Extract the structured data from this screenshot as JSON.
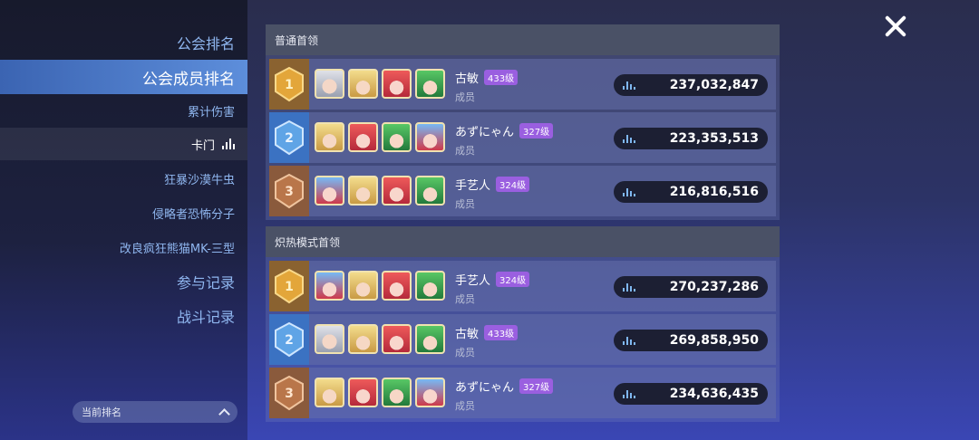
{
  "sidebar": {
    "items": [
      {
        "label": "公会排名"
      },
      {
        "label": "公会成员排名"
      },
      {
        "label": "累计伤害"
      },
      {
        "label": "卡门"
      },
      {
        "label": "狂暴沙漠牛虫"
      },
      {
        "label": "侵略者恐怖分子"
      },
      {
        "label": "改良疯狂熊猫MK-三型"
      },
      {
        "label": "参与记录"
      },
      {
        "label": "战斗记录"
      }
    ],
    "current_rank_label": "当前排名"
  },
  "sections": [
    {
      "title": "普通首领",
      "rows": [
        {
          "rank": "1",
          "name": "古敏",
          "level": "433级",
          "role": "成员",
          "score": "237,032,847"
        },
        {
          "rank": "2",
          "name": "あずにゃん",
          "level": "327级",
          "role": "成员",
          "score": "223,353,513"
        },
        {
          "rank": "3",
          "name": "手艺人",
          "level": "324级",
          "role": "成员",
          "score": "216,816,516"
        }
      ]
    },
    {
      "title": "炽热模式首领",
      "rows": [
        {
          "rank": "1",
          "name": "手艺人",
          "level": "324级",
          "role": "成员",
          "score": "270,237,286"
        },
        {
          "rank": "2",
          "name": "古敏",
          "level": "433级",
          "role": "成员",
          "score": "269,858,950"
        },
        {
          "rank": "3",
          "name": "あずにゃん",
          "level": "327级",
          "role": "成员",
          "score": "234,636,435"
        }
      ]
    }
  ]
}
